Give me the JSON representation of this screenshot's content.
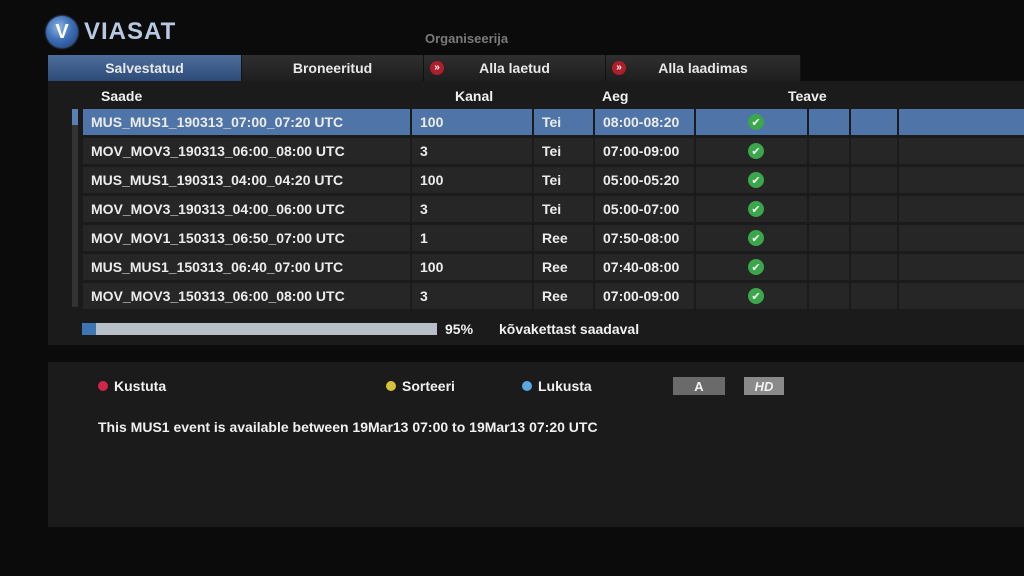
{
  "brand": {
    "logo_letter": "V",
    "name": "VIASAT"
  },
  "page_title": "Organiseerija",
  "tabs": [
    {
      "label": "Salvestatud",
      "active": true,
      "rec_icon": false
    },
    {
      "label": "Broneeritud",
      "active": false,
      "rec_icon": false
    },
    {
      "label": "Alla laetud",
      "active": false,
      "rec_icon": true
    },
    {
      "label": "Alla laadimas",
      "active": false,
      "rec_icon": true
    }
  ],
  "rec_glyph": "»",
  "columns": {
    "saade": "Saade",
    "kanal": "Kanal",
    "aeg": "Aeg",
    "teave": "Teave"
  },
  "recordings": [
    {
      "title": "MUS_MUS1_190313_07:00_07:20 UTC",
      "channel": "100",
      "day": "Tei",
      "time": "08:00-08:20",
      "selected": true
    },
    {
      "title": "MOV_MOV3_190313_06:00_08:00 UTC",
      "channel": "3",
      "day": "Tei",
      "time": "07:00-09:00",
      "selected": false
    },
    {
      "title": "MUS_MUS1_190313_04:00_04:20 UTC",
      "channel": "100",
      "day": "Tei",
      "time": "05:00-05:20",
      "selected": false
    },
    {
      "title": "MOV_MOV3_190313_04:00_06:00 UTC",
      "channel": "3",
      "day": "Tei",
      "time": "05:00-07:00",
      "selected": false
    },
    {
      "title": "MOV_MOV1_150313_06:50_07:00 UTC",
      "channel": "1",
      "day": "Ree",
      "time": "07:50-08:00",
      "selected": false
    },
    {
      "title": "MUS_MUS1_150313_06:40_07:00 UTC",
      "channel": "100",
      "day": "Ree",
      "time": "07:40-08:00",
      "selected": false
    },
    {
      "title": "MOV_MOV3_150313_06:00_08:00 UTC",
      "channel": "3",
      "day": "Ree",
      "time": "07:00-09:00",
      "selected": false
    }
  ],
  "check_glyph": "✔",
  "disk": {
    "fill_fraction": 0.04,
    "percent_label": "95%",
    "label": "kõvakettast saadaval"
  },
  "actions": [
    {
      "label": "Kustuta",
      "color": "#d0264a"
    },
    {
      "label": "Sorteeri",
      "color": "#d4c23a"
    },
    {
      "label": "Lukusta",
      "color": "#5aa8e0"
    }
  ],
  "badges": {
    "a": "A",
    "hd": "HD"
  },
  "description": "This MUS1 event is available between 19Mar13 07:00 to 19Mar13 07:20 UTC",
  "colors": {
    "accent": "#4f74a8",
    "check": "#3aa84a",
    "rec": "#b01e2c"
  }
}
